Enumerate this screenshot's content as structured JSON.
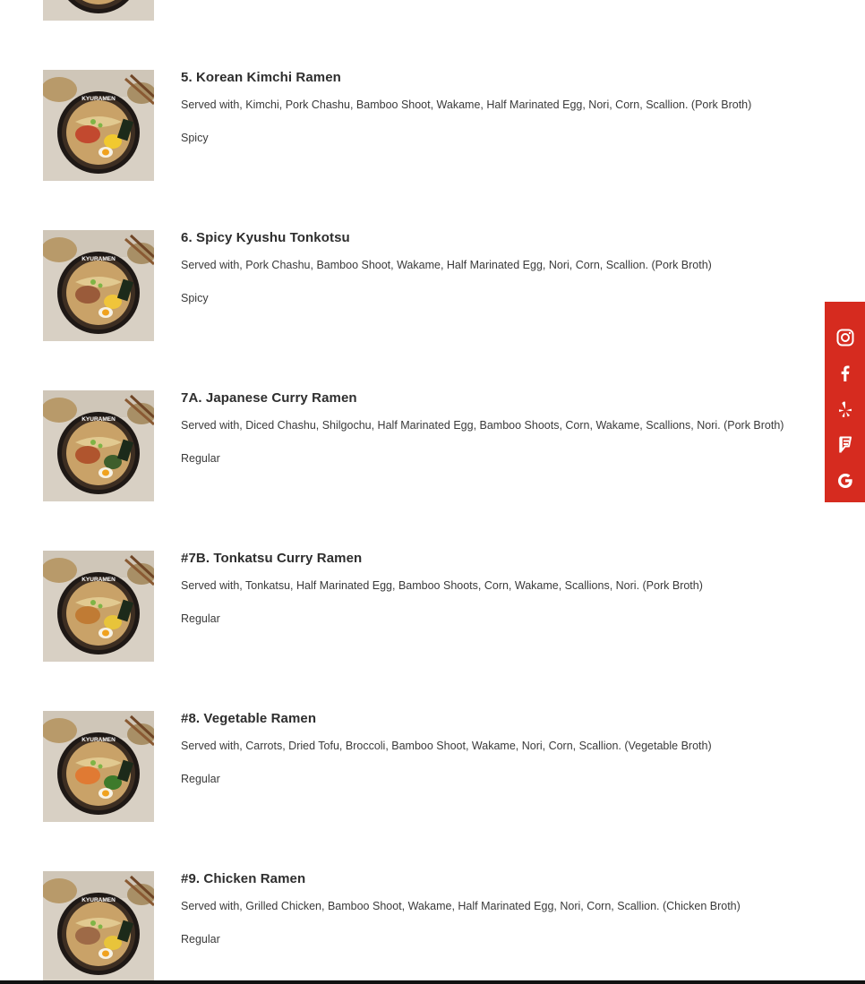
{
  "menu": {
    "items": [
      {
        "title": "",
        "description": "",
        "tag": ""
      },
      {
        "title": "5. Korean Kimchi Ramen",
        "description": "Served with, Kimchi, Pork Chashu, Bamboo Shoot, Wakame, Half Marinated Egg, Nori, Corn, Scallion. (Pork Broth)",
        "tag": "Spicy"
      },
      {
        "title": "6. Spicy Kyushu Tonkotsu",
        "description": "Served with, Pork Chashu, Bamboo Shoot, Wakame, Half Marinated Egg, Nori, Corn, Scallion. (Pork Broth)",
        "tag": "Spicy"
      },
      {
        "title": "7A. Japanese Curry Ramen",
        "description": "Served with, Diced Chashu, Shilgochu, Half Marinated Egg, Bamboo Shoots, Corn, Wakame, Scallions, Nori. (Pork Broth)",
        "tag": "Regular"
      },
      {
        "title": "#7B. Tonkatsu Curry Ramen",
        "description": "Served with, Tonkatsu, Half Marinated Egg, Bamboo Shoots, Corn, Wakame, Scallions, Nori. (Pork Broth)",
        "tag": "Regular"
      },
      {
        "title": "#8. Vegetable Ramen",
        "description": "Served with, Carrots, Dried Tofu, Broccoli, Bamboo Shoot, Wakame, Nori, Corn, Scallion. (Vegetable Broth)",
        "tag": "Regular"
      },
      {
        "title": "#9. Chicken Ramen",
        "description": "Served with, Grilled Chicken, Bamboo Shoot, Wakame, Half Marinated Egg, Nori, Corn, Scallion. (Chicken Broth)",
        "tag": "Regular"
      }
    ],
    "bowl_brand": "KYURAMEN"
  },
  "social": {
    "accent_color": "#d62b1f",
    "icons": [
      "instagram-icon",
      "facebook-icon",
      "yelp-icon",
      "foursquare-icon",
      "google-icon"
    ]
  }
}
